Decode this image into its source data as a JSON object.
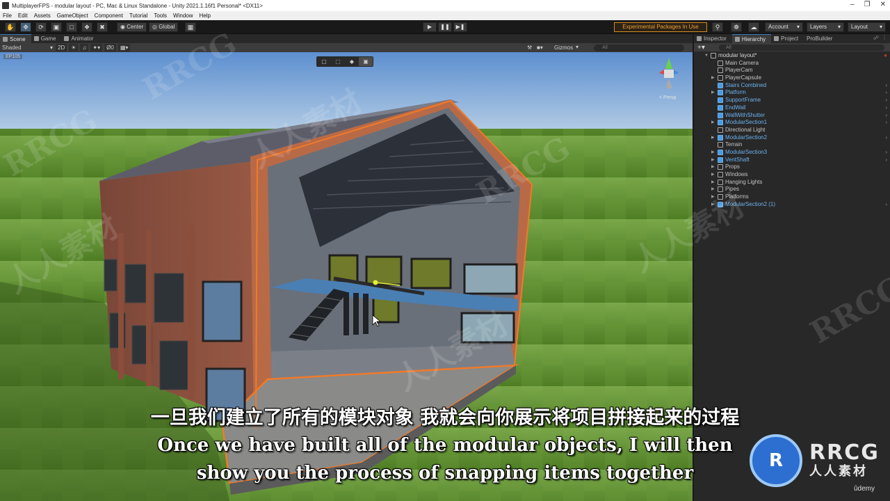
{
  "window": {
    "title": "MultiplayerFPS - modular layout - PC, Mac & Linux Standalone - Unity 2021.1.16f1 Personal* <DX11>"
  },
  "menu": [
    "File",
    "Edit",
    "Assets",
    "GameObject",
    "Component",
    "Tutorial",
    "Tools",
    "Window",
    "Help"
  ],
  "toolbar": {
    "tools": [
      "hand-icon",
      "move-icon",
      "rotate-icon",
      "scale-icon",
      "rect-icon",
      "transform-icon",
      "custom-tool-icon"
    ],
    "pivot_label": "Center",
    "space_label": "Global",
    "experimental_label": "Experimental Packages In Use",
    "account_label": "Account",
    "layers_label": "Layers",
    "layout_label": "Layout",
    "accent_color": "#d58a1e"
  },
  "left_tabs": [
    "Scene",
    "Game",
    "Animator"
  ],
  "scene_bar": {
    "shading": "Shaded",
    "mode_2d": "2D",
    "fx_count": "0",
    "gizmos_label": "Gizmos",
    "search_placeholder": "All",
    "persp_label": "Persp"
  },
  "right_tabs": [
    "Inspector",
    "Hierarchy",
    "Project",
    "ProBuilder"
  ],
  "hierarchy": {
    "search_placeholder": "All",
    "items": [
      {
        "label": "modular layout*",
        "level": 0,
        "arrow": "open",
        "prefab": false,
        "root": true
      },
      {
        "label": "Main Camera",
        "level": 1,
        "arrow": "",
        "prefab": false
      },
      {
        "label": "PlayerCam",
        "level": 1,
        "arrow": "",
        "prefab": false
      },
      {
        "label": "PlayerCapsule",
        "level": 1,
        "arrow": "closed",
        "prefab": false
      },
      {
        "label": "Stairs Combined",
        "level": 1,
        "arrow": "",
        "prefab": true
      },
      {
        "label": "Platform",
        "level": 1,
        "arrow": "closed",
        "prefab": true
      },
      {
        "label": "SupportFrame",
        "level": 1,
        "arrow": "",
        "prefab": true
      },
      {
        "label": "EndWall",
        "level": 1,
        "arrow": "",
        "prefab": true
      },
      {
        "label": "WallWithShutter",
        "level": 1,
        "arrow": "",
        "prefab": true
      },
      {
        "label": "ModularSection1",
        "level": 1,
        "arrow": "closed",
        "prefab": true
      },
      {
        "label": "Directional Light",
        "level": 1,
        "arrow": "",
        "prefab": false
      },
      {
        "label": "ModularSection2",
        "level": 1,
        "arrow": "closed",
        "prefab": true
      },
      {
        "label": "Terrain",
        "level": 1,
        "arrow": "",
        "prefab": false
      },
      {
        "label": "ModularSection3",
        "level": 1,
        "arrow": "closed",
        "prefab": true
      },
      {
        "label": "VentShaft",
        "level": 1,
        "arrow": "closed",
        "prefab": true
      },
      {
        "label": "Props",
        "level": 1,
        "arrow": "closed",
        "prefab": false
      },
      {
        "label": "Windows",
        "level": 1,
        "arrow": "closed",
        "prefab": false
      },
      {
        "label": "Hanging Lights",
        "level": 1,
        "arrow": "closed",
        "prefab": false
      },
      {
        "label": "Pipes",
        "level": 1,
        "arrow": "closed",
        "prefab": false
      },
      {
        "label": "Platforms",
        "level": 1,
        "arrow": "closed",
        "prefab": false
      },
      {
        "label": "ModularSection2 (1)",
        "level": 1,
        "arrow": "closed",
        "prefab": true
      }
    ]
  },
  "subtitles": {
    "chinese": "一旦我们建立了所有的模块对象 我就会向你展示将项目拼接起来的过程",
    "english_line1": "Once we have built all of the modular objects, I will then",
    "english_line2": "show you the process of snapping items together"
  },
  "watermark": {
    "logo_text": "RRCG",
    "logo_sub": "人人素材",
    "udemy": "ûdemy",
    "tiles": [
      "RRCG",
      "人人素材",
      "RRCG",
      "人人素材",
      "RRCG",
      "人人素材",
      "RRCG",
      "人人素材"
    ]
  }
}
